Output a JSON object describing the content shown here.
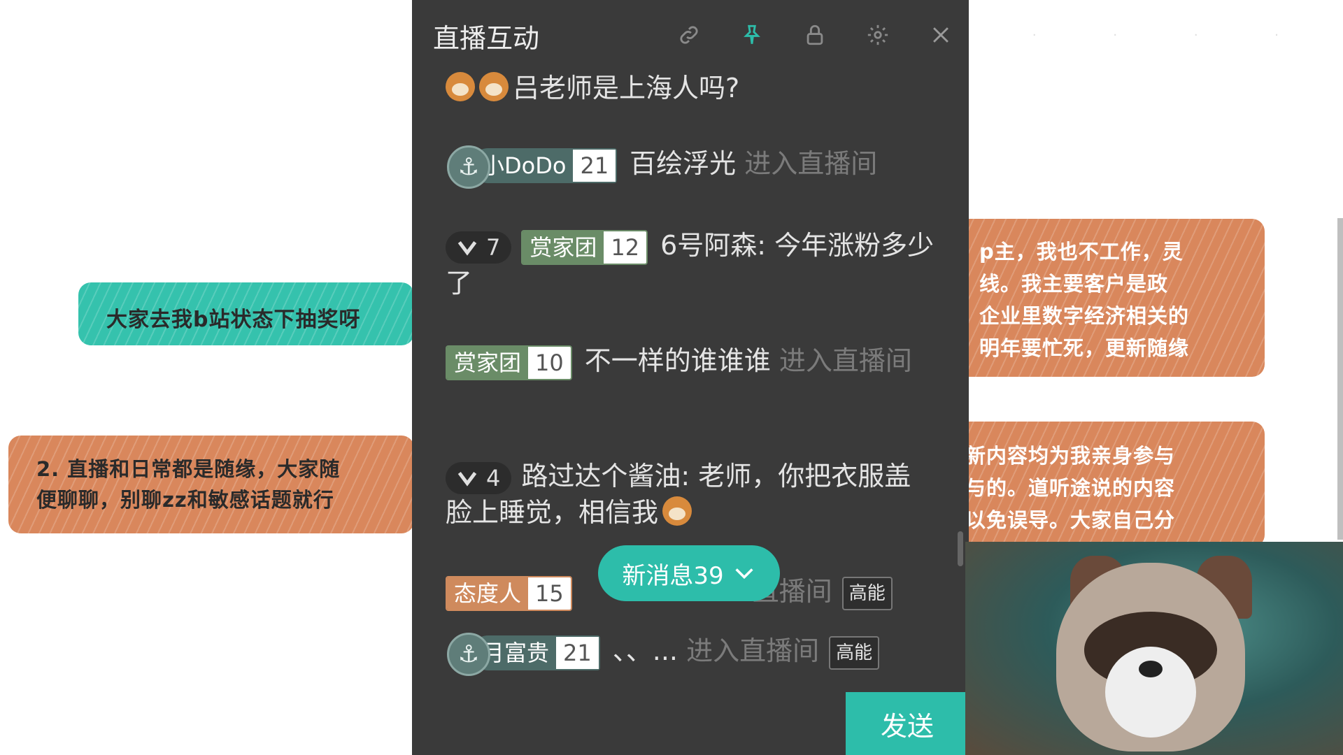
{
  "background_notes": {
    "left_1": "大家去我b站状态下抽奖呀",
    "left_2": "2. 直播和日常都是随缘，大家随\n便聊聊，别聊zz和敏感话题就行",
    "right_1": "p主，我也不工作，灵\n线。我主要客户是政\n企业里数字经济相关的\n明年要忙死，更新随缘",
    "right_2": "新内容均为我亲身参与\n与的。道听途说的内容\n以免误导。大家自己分"
  },
  "panel": {
    "title": "直播互动",
    "icons": [
      "link-icon",
      "pin-icon",
      "lock-icon",
      "gear-icon",
      "close-icon"
    ]
  },
  "messages": [
    {
      "text": "吕老师是上海人吗?"
    },
    {
      "badge_name": "小DoDo",
      "badge_level": "21",
      "user": "百绘浮光",
      "action": "进入直播间"
    },
    {
      "heart_level": "7",
      "badge_name": "赏家团",
      "badge_level": "12",
      "user": "6号阿森:",
      "text": "今年涨粉多少了"
    },
    {
      "badge_name": "赏家团",
      "badge_level": "10",
      "user": "不一样的谁谁谁",
      "action": "进入直播间"
    },
    {
      "heart_level": "4",
      "user": "路过达个酱油:",
      "text": "老师，你把衣服盖脸上睡觉，相信我"
    },
    {
      "badge_name": "态度人",
      "badge_level": "15",
      "action": "直播间",
      "tag": "高能"
    },
    {
      "badge_name": "月富贵",
      "badge_level": "21",
      "user": "、、...",
      "action": "进入直播间",
      "tag": "高能"
    }
  ],
  "new_message_button": "新消息39",
  "send_button": "发送"
}
